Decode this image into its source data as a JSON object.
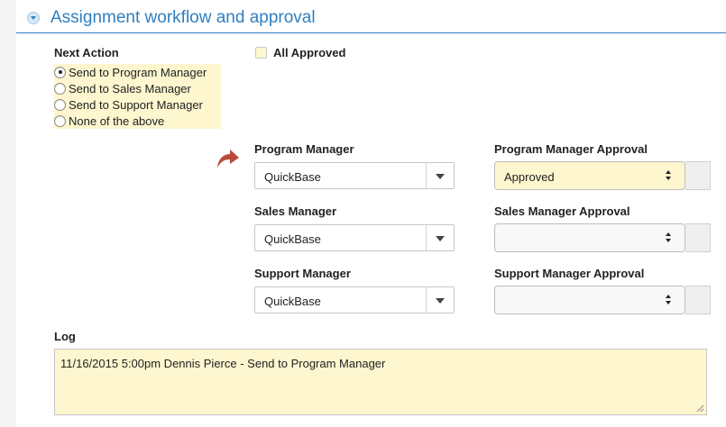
{
  "section": {
    "title": "Assignment workflow and approval",
    "toggle_icon": "collapse-chevron-icon"
  },
  "next_action": {
    "label": "Next Action",
    "options": [
      {
        "label": "Send to Program Manager",
        "checked": true
      },
      {
        "label": "Send to Sales Manager",
        "checked": false
      },
      {
        "label": "Send to Support Manager",
        "checked": false
      },
      {
        "label": "None of the above",
        "checked": false
      }
    ]
  },
  "all_approved": {
    "label": "All Approved",
    "checked": false
  },
  "indicator_icon": "redirect-arrow-icon",
  "managers": [
    {
      "label": "Program Manager",
      "value": "QuickBase"
    },
    {
      "label": "Sales Manager",
      "value": "QuickBase"
    },
    {
      "label": "Support Manager",
      "value": "QuickBase"
    }
  ],
  "approvals": [
    {
      "label": "Program Manager Approval",
      "value": "Approved"
    },
    {
      "label": "Sales Manager Approval",
      "value": ""
    },
    {
      "label": "Support Manager Approval",
      "value": ""
    }
  ],
  "log": {
    "label": "Log",
    "value": "11/16/2015 5:00pm Dennis Pierce - Send to Program Manager"
  },
  "colors": {
    "accent": "#2f7fc1",
    "highlight": "#fdf6cf",
    "arrow": "#b84a3c"
  }
}
